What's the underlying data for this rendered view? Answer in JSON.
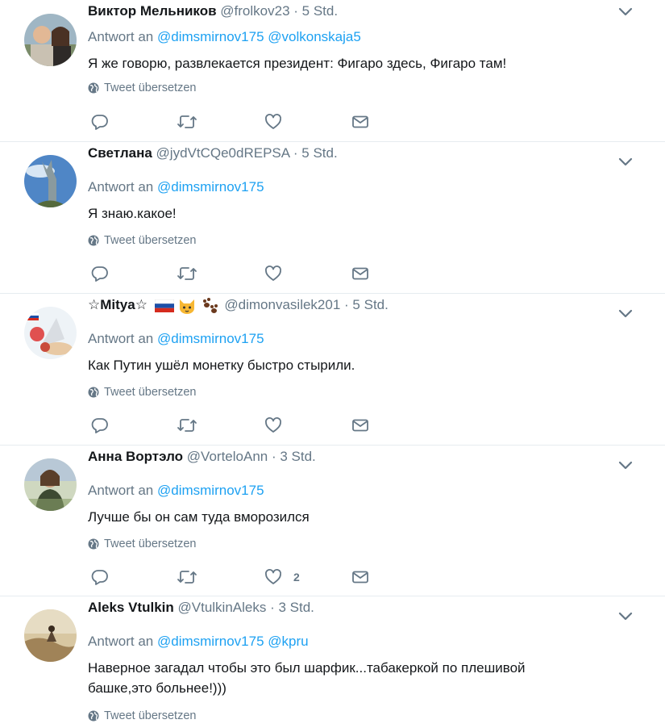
{
  "translate_label": "Tweet übersetzen",
  "reply_prefix": "Antwort an",
  "colors": {
    "link": "#1da1f2",
    "muted": "#657786",
    "text": "#14171a",
    "border": "#e6ecf0"
  },
  "tweets": [
    {
      "fullname": "Виктор Мельников",
      "username": "@frolkov23",
      "time": "5 Std.",
      "mentions": [
        "@dimsmirnov175",
        "@volkonskaja5"
      ],
      "text": "Я же говорю, развлекается президент: Фигаро здесь, Фигаро там!",
      "like_count": ""
    },
    {
      "fullname": "Светлана",
      "username": "@jydVtCQe0dREPSA",
      "time": "5 Std.",
      "mentions": [
        "@dimsmirnov175"
      ],
      "text": "Я знаю.какое!",
      "like_count": ""
    },
    {
      "fullname": "☆Mitya☆",
      "username": "@dimonvasilek201",
      "time": "5 Std.",
      "mentions": [
        "@dimsmirnov175"
      ],
      "text": "Как Путин ушёл монетку быстро стырили.",
      "like_count": ""
    },
    {
      "fullname": "Анна Вортэло",
      "username": "@VorteloAnn",
      "time": "3 Std.",
      "mentions": [
        "@dimsmirnov175"
      ],
      "text": "Лучше бы он сам туда вморозился",
      "like_count": "2"
    },
    {
      "fullname": "Aleks Vtulkin",
      "username": "@VtulkinAleks",
      "time": "3 Std.",
      "mentions": [
        "@dimsmirnov175",
        "@kpru"
      ],
      "text_line1": "Наверное загадал чтобы это был шарфик...табакеркой по плешивой",
      "text_line2": "башке,это больнее!)))",
      "like_count": ""
    }
  ]
}
